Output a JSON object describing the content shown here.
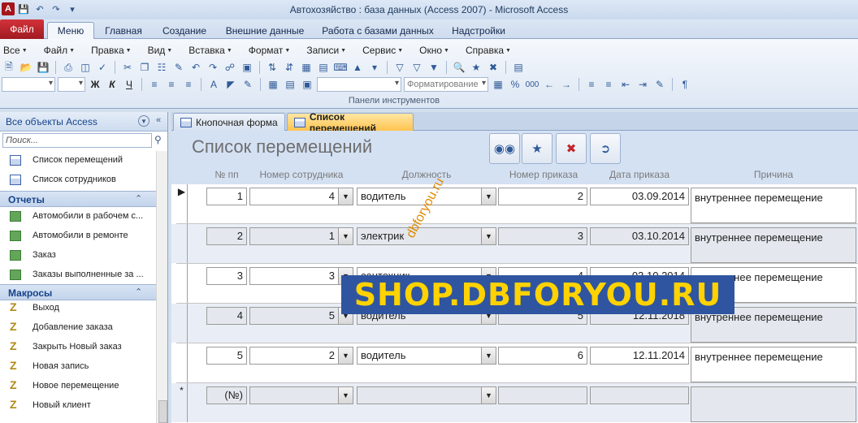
{
  "window": {
    "title": "Автохозяйство : база данных (Access 2007)  -  Microsoft Access",
    "app_icon": "A"
  },
  "ribbon_tabs": {
    "file": "Файл",
    "items": [
      "Меню",
      "Главная",
      "Создание",
      "Внешние данные",
      "Работа с базами данных",
      "Надстройки"
    ],
    "active": "Меню"
  },
  "menus": [
    "Все",
    "Файл",
    "Правка",
    "Вид",
    "Вставка",
    "Формат",
    "Записи",
    "Сервис",
    "Окно",
    "Справка"
  ],
  "toolbar": {
    "format_combo_placeholder": "Форматирование",
    "group_label": "Панели инструментов"
  },
  "nav": {
    "header": "Все объекты Access",
    "search_placeholder": "Поиск...",
    "forms": [
      "Список перемещений",
      "Список сотрудников"
    ],
    "reports_group": "Отчеты",
    "reports": [
      "Автомобили в рабочем с...",
      "Автомобили в ремонте",
      "Заказ",
      "Заказы выполненные за ..."
    ],
    "macros_group": "Макросы",
    "macros": [
      "Выход",
      "Добавление заказа",
      "Закрыть Новый заказ",
      "Новая запись",
      "Новое перемещение",
      "Новый клиент"
    ]
  },
  "doc_tabs": [
    "Кнопочная форма",
    "Список перемещений"
  ],
  "form": {
    "title": "Список перемещений",
    "columns": {
      "num": "№ пп",
      "employee": "Номер сотрудника",
      "position": "Должность",
      "order": "Номер приказа",
      "date": "Дата приказа",
      "reason": "Причина"
    },
    "records": [
      {
        "num": "1",
        "employee": "4",
        "position": "водитель",
        "order": "2",
        "date": "03.09.2014",
        "reason": "внутреннее перемещение"
      },
      {
        "num": "2",
        "employee": "1",
        "position": "электрик",
        "order": "3",
        "date": "03.10.2014",
        "reason": "внутреннее перемещение"
      },
      {
        "num": "3",
        "employee": "3",
        "position": "сантехник",
        "order": "4",
        "date": "03.10.2014",
        "reason": "внутреннее перемещение"
      },
      {
        "num": "4",
        "employee": "5",
        "position": "водитель",
        "order": "5",
        "date": "12.11.2018",
        "reason": "внутреннее перемещение"
      },
      {
        "num": "5",
        "employee": "2",
        "position": "водитель",
        "order": "6",
        "date": "12.11.2014",
        "reason": "внутреннее перемещение"
      }
    ],
    "new_record_num": "(№)",
    "current_marker": "▶",
    "new_marker": "*"
  },
  "watermark": "dbforyou.ru",
  "banner": "SHOP.DBFORYOU.RU",
  "colors": {
    "accent": "#ffc44f",
    "banner_bg": "#2f55a0",
    "banner_text": "#ffd200",
    "file_tab": "#c0262d"
  }
}
